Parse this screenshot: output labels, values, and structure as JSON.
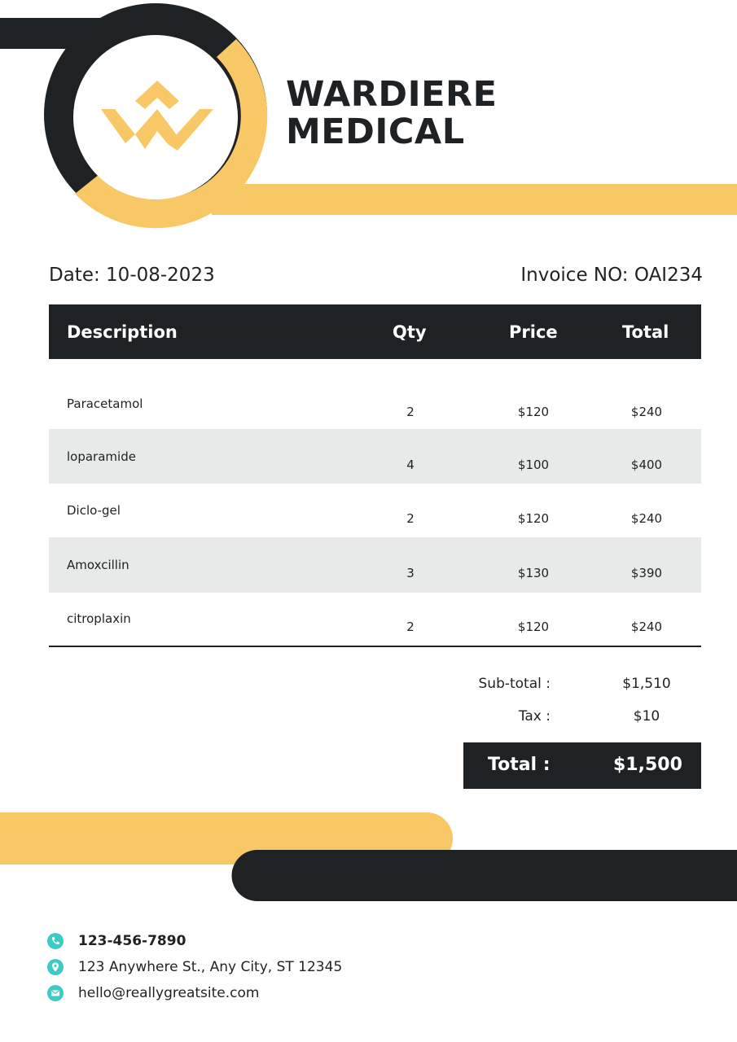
{
  "brand": {
    "name_line1": "WARDIERE",
    "name_line2": "MEDICAL",
    "logo": "wardiere-w-logo"
  },
  "colors": {
    "dark": "#1f2224",
    "accent": "#f9c866",
    "row_shade": "#e8e9e9",
    "icon": "#3fcac6"
  },
  "invoice": {
    "date_label": "Date:",
    "date_value": "10-08-2023",
    "number_label": "Invoice NO:",
    "number_value": "OAI234"
  },
  "table": {
    "headers": {
      "description": "Description",
      "qty": "Qty",
      "price": "Price",
      "total": "Total"
    },
    "rows": [
      {
        "description": "Paracetamol",
        "qty": "2",
        "price": "$120",
        "total": "$240"
      },
      {
        "description": "loparamide",
        "qty": "4",
        "price": "$100",
        "total": "$400"
      },
      {
        "description": "Diclo-gel",
        "qty": "2",
        "price": "$120",
        "total": "$240"
      },
      {
        "description": "Amoxcillin",
        "qty": "3",
        "price": "$130",
        "total": "$390"
      },
      {
        "description": "citroplaxin",
        "qty": "2",
        "price": "$120",
        "total": "$240"
      }
    ]
  },
  "summary": {
    "subtotal_label": "Sub-total :",
    "subtotal_value": "$1,510",
    "tax_label": "Tax :",
    "tax_value": "$10",
    "total_label": "Total :",
    "total_value": "$1,500"
  },
  "contact": {
    "phone": "123-456-7890",
    "address": "123 Anywhere St., Any City, ST 12345",
    "email": "hello@reallygreatsite.com",
    "icons": [
      "phone-icon",
      "location-pin-icon",
      "mail-icon"
    ]
  }
}
